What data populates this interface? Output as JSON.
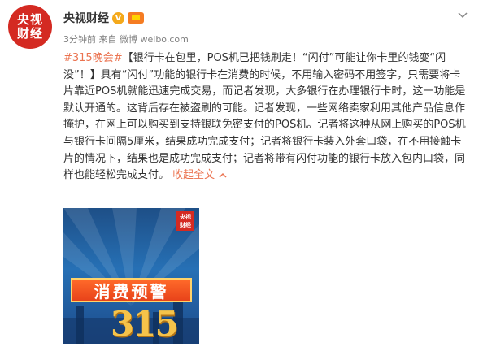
{
  "post": {
    "author": {
      "avatar_line1": "央视",
      "avatar_line2": "财经",
      "name": "央视财经",
      "verified_icon": "verified-v-icon",
      "member_icon": "member-crown-icon"
    },
    "time": "3分钟前",
    "source_prefix": "来自",
    "source": "微博 weibo.com",
    "hashtag": "#315晚会#",
    "body": "【银行卡在包里，POS机已把钱刷走！“闪付”可能让你卡里的钱变“闪没”！】具有“闪付”功能的银行卡在消费的时候，不用输入密码不用签字，只需要将卡片靠近POS机就能迅速完成交易，而记者发现，大多银行在办理银行卡时，这一功能是默认开通的。这背后存在被盗刷的可能。记者发现，一些网络卖家利用其他产品信息作掩护，在网上可以购买到支持银联免密支付的POS机。记者将这种从网上购买的POS机与银行卡间隔5厘米，结果成功完成支付；记者将银行卡装入外套口袋，在不用接触卡片的情况下，结果也是成功完成支付；记者将带有闪付功能的银行卡放入包内口袋，同样也能轻松完成支付。",
    "collapse_label": "收起全文",
    "collapse_icon": "chevron-up-icon",
    "menu_icon": "chevron-down-icon",
    "image": {
      "logo_line1": "央视",
      "logo_line2": "财经",
      "banner_text": "消费预警",
      "number_text": "315"
    }
  },
  "colors": {
    "link": "#eb7350",
    "avatar_red": "#d42a22",
    "verified_gold": "#f4a91b",
    "image_blue": "#2670b5"
  }
}
